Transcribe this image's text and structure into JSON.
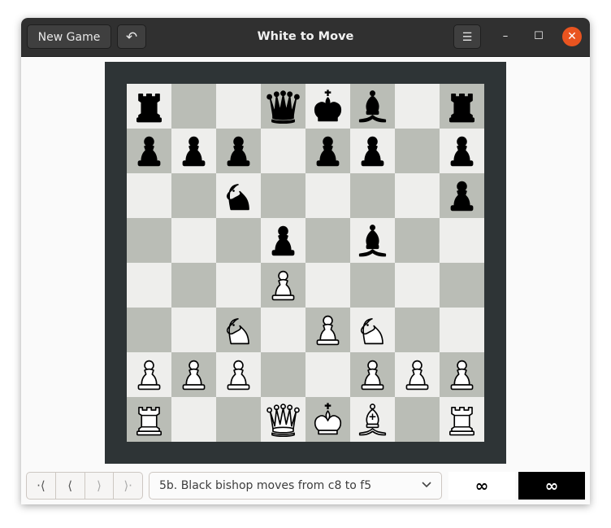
{
  "window": {
    "title": "White to Move",
    "new_game_label": "New Game",
    "undo_icon": "↶",
    "menu_icon": "☰",
    "minimize_icon": "–",
    "maximize_icon": "☐",
    "close_icon": "✕"
  },
  "board": {
    "light_color": "#eeeeec",
    "dark_color": "#babdb6",
    "frame_color": "#2e3436",
    "files": [
      "a",
      "b",
      "c",
      "d",
      "e",
      "f",
      "g",
      "h"
    ],
    "ranks": [
      8,
      7,
      6,
      5,
      4,
      3,
      2,
      1
    ],
    "position": [
      [
        "br",
        "",
        "",
        "bq",
        "bk",
        "bb",
        "",
        "br"
      ],
      [
        "bp",
        "bp",
        "bp",
        "",
        "bp",
        "bp",
        "",
        "bp"
      ],
      [
        "",
        "",
        "bn",
        "",
        "",
        "",
        "",
        "bp"
      ],
      [
        "",
        "",
        "",
        "bp",
        "",
        "bb",
        "",
        ""
      ],
      [
        "",
        "",
        "",
        "wp",
        "",
        "",
        "",
        ""
      ],
      [
        "",
        "",
        "wn",
        "",
        "wp",
        "wn",
        "",
        ""
      ],
      [
        "wp",
        "wp",
        "wp",
        "",
        "",
        "wp",
        "wp",
        "wp"
      ],
      [
        "wr",
        "",
        "",
        "wq",
        "wk",
        "wb",
        "",
        "wr"
      ]
    ]
  },
  "navigation": {
    "first_label": "·⟨",
    "prev_label": "⟨",
    "next_label": "⟩",
    "last_label": "⟩·"
  },
  "move_history": {
    "selected": "5b. Black bishop moves from c8 to f5"
  },
  "clocks": {
    "white": "∞",
    "black": "∞"
  }
}
